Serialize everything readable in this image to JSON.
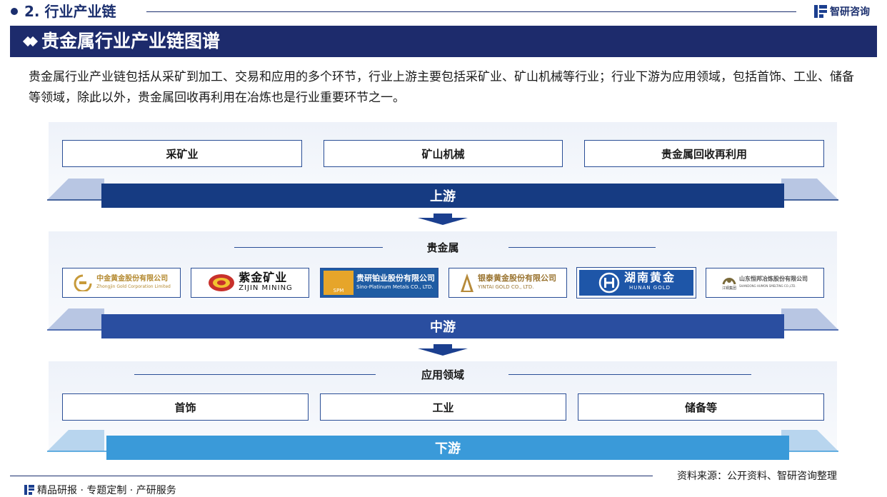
{
  "section": {
    "title": "2. 行业产业链"
  },
  "brand": {
    "name": "智研咨询"
  },
  "banner": {
    "title": "贵金属行业产业链图谱"
  },
  "description": "贵金属行业产业链包括从采矿到加工、交易和应用的多个环节，行业上游主要包括采矿业、矿山机械等行业；行业下游为应用领域，包括首饰、工业、储备等领域，除此以外，贵金属回收再利用在冶炼也是行业重要环节之一。",
  "upstream": {
    "items": [
      "采矿业",
      "矿山机械",
      "贵金属回收再利用"
    ],
    "label": "上游"
  },
  "midstream": {
    "heading": "贵金属",
    "label": "中游",
    "logos": [
      {
        "name": "中金黄金股份有限公司",
        "sub": "Zhongjin Gold Corporation Limited",
        "icon": "zhongjin-logo-icon"
      },
      {
        "name": "紫金矿业",
        "sub": "ZIJIN MINING",
        "icon": "zijin-logo-icon"
      },
      {
        "name": "贵研铂业股份有限公司",
        "sub": "Sino-Platinum Metals CO., LTD.",
        "icon": "spm-logo-icon",
        "mark": "SPM"
      },
      {
        "name": "银泰黄金股份有限公司",
        "sub": "YINTAI GOLD CO., LTD.",
        "icon": "yintai-logo-icon"
      },
      {
        "name": "湖南黄金",
        "sub": "HUNAN GOLD",
        "icon": "hunan-gold-logo-icon"
      },
      {
        "name": "山东恒邦冶炼股份有限公司",
        "sub": "SHANDONG HUMON SMELTING CO.,LTD.",
        "icon": "humon-logo-icon",
        "extra": "江铜集团"
      }
    ]
  },
  "downstream": {
    "heading": "应用领域",
    "items": [
      "首饰",
      "工业",
      "储备等"
    ],
    "label": "下游"
  },
  "footer": {
    "source": "资料来源：公开资料、智研咨询整理",
    "tagline": "精品研报 · 专题定制 · 产研服务"
  },
  "colors": {
    "navy": "#1d2b6c",
    "upstream_bar": "#163b82",
    "midstream_bar": "#2a4ea0",
    "downstream_bar": "#3a9ad9",
    "border": "#2a4e96"
  }
}
